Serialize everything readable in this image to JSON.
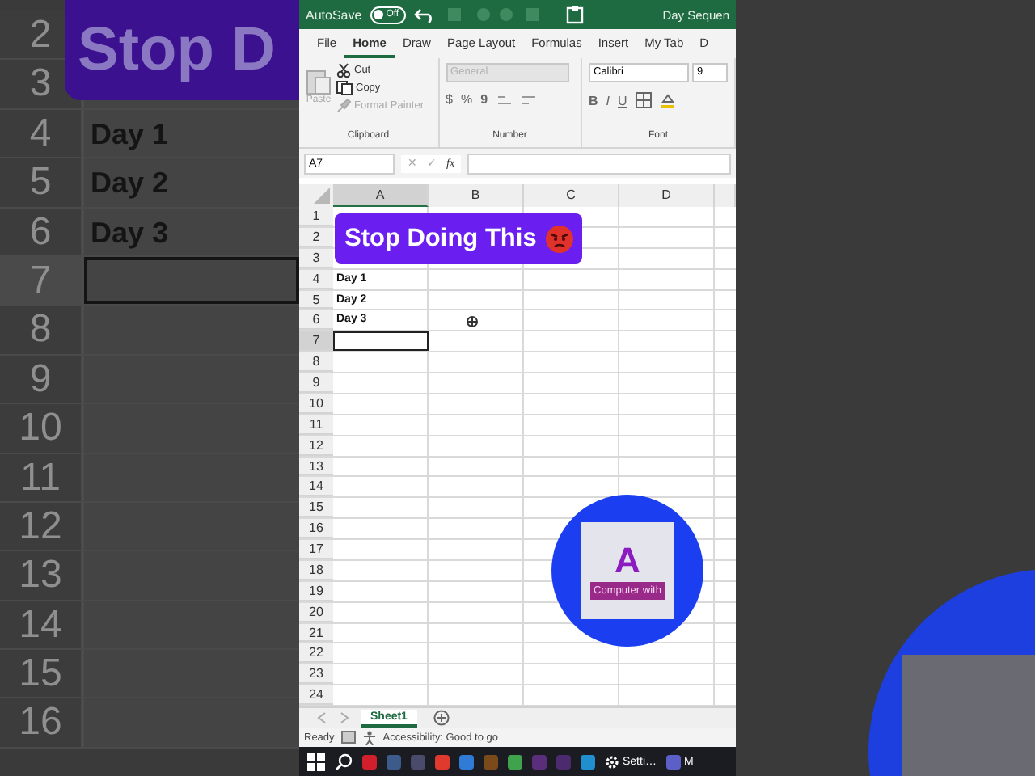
{
  "backdrop_left": {
    "banner_text": "Stop D",
    "rows": [
      {
        "number": "2",
        "selected": false,
        "cell": ""
      },
      {
        "number": "3",
        "selected": false,
        "cell": ""
      },
      {
        "number": "4",
        "selected": false,
        "cell": "Day 1"
      },
      {
        "number": "5",
        "selected": false,
        "cell": "Day 2"
      },
      {
        "number": "6",
        "selected": false,
        "cell": "Day 3"
      },
      {
        "number": "7",
        "selected": true,
        "cell": ""
      },
      {
        "number": "8",
        "selected": false,
        "cell": ""
      },
      {
        "number": "9",
        "selected": false,
        "cell": ""
      },
      {
        "number": "10",
        "selected": false,
        "cell": ""
      },
      {
        "number": "11",
        "selected": false,
        "cell": ""
      },
      {
        "number": "12",
        "selected": false,
        "cell": ""
      },
      {
        "number": "13",
        "selected": false,
        "cell": ""
      },
      {
        "number": "14",
        "selected": false,
        "cell": ""
      },
      {
        "number": "15",
        "selected": false,
        "cell": ""
      },
      {
        "number": "16",
        "selected": false,
        "cell": ""
      }
    ]
  },
  "title_bar": {
    "autosave_label": "AutoSave",
    "autosave_state": "Off",
    "autosave_on": false,
    "title": "Day Sequen"
  },
  "tabs": [
    {
      "label": "File",
      "selected": false
    },
    {
      "label": "Home",
      "selected": true
    },
    {
      "label": "Draw",
      "selected": false
    },
    {
      "label": "Page Layout",
      "selected": false
    },
    {
      "label": "Formulas",
      "selected": false
    },
    {
      "label": "Insert",
      "selected": false
    },
    {
      "label": "My Tab",
      "selected": false
    },
    {
      "label": "D",
      "selected": false
    }
  ],
  "ribbon": {
    "clipboard": {
      "paste": "Paste",
      "cut": "Cut",
      "copy": "Copy",
      "format_painter": "Format Painter",
      "label": "Clipboard"
    },
    "number": {
      "format": "General",
      "currency": "$",
      "percent": "%",
      "comma": "9",
      "label": "Number"
    },
    "font": {
      "name": "Calibri",
      "size": "9",
      "bold": "B",
      "italic": "I",
      "underline": "U",
      "label": "Font"
    }
  },
  "formula_bar": {
    "name_box": "A7",
    "cancel": "✕",
    "enter": "✓",
    "fx": "fx"
  },
  "sheet": {
    "columns": [
      {
        "label": "A",
        "selected": true
      },
      {
        "label": "B",
        "selected": false
      },
      {
        "label": "C",
        "selected": false
      },
      {
        "label": "D",
        "selected": false
      }
    ],
    "rows": [
      {
        "number": "1",
        "selected": false,
        "cell": ""
      },
      {
        "number": "2",
        "selected": false,
        "cell": ""
      },
      {
        "number": "3",
        "selected": false,
        "cell": ""
      },
      {
        "number": "4",
        "selected": false,
        "cell": "Day 1"
      },
      {
        "number": "5",
        "selected": false,
        "cell": "Day 2"
      },
      {
        "number": "6",
        "selected": false,
        "cell": "Day 3"
      },
      {
        "number": "7",
        "selected": true,
        "cell": ""
      },
      {
        "number": "8",
        "selected": false,
        "cell": ""
      },
      {
        "number": "9",
        "selected": false,
        "cell": ""
      },
      {
        "number": "10",
        "selected": false,
        "cell": ""
      },
      {
        "number": "11",
        "selected": false,
        "cell": ""
      },
      {
        "number": "12",
        "selected": false,
        "cell": ""
      },
      {
        "number": "13",
        "selected": false,
        "cell": ""
      },
      {
        "number": "14",
        "selected": false,
        "cell": ""
      },
      {
        "number": "15",
        "selected": false,
        "cell": ""
      },
      {
        "number": "16",
        "selected": false,
        "cell": ""
      },
      {
        "number": "17",
        "selected": false,
        "cell": ""
      },
      {
        "number": "18",
        "selected": false,
        "cell": ""
      },
      {
        "number": "19",
        "selected": false,
        "cell": ""
      },
      {
        "number": "20",
        "selected": false,
        "cell": ""
      },
      {
        "number": "21",
        "selected": false,
        "cell": ""
      },
      {
        "number": "22",
        "selected": false,
        "cell": ""
      },
      {
        "number": "23",
        "selected": false,
        "cell": ""
      },
      {
        "number": "24",
        "selected": false,
        "cell": ""
      }
    ]
  },
  "overlay_banner": {
    "text": "Stop Doing This"
  },
  "logo": {
    "letter": "A",
    "caption": "Computer with"
  },
  "sheet_tabs": [
    {
      "label": "Sheet1",
      "selected": true
    }
  ],
  "status_bar": {
    "mode": "Ready",
    "accessibility": "Accessibility: Good to go"
  },
  "taskbar": [
    {
      "kind": "start"
    },
    {
      "kind": "search"
    },
    {
      "kind": "app",
      "color": "#d21f2b"
    },
    {
      "kind": "app",
      "color": "#3c5a8a"
    },
    {
      "kind": "app",
      "color": "#4a4a6a"
    },
    {
      "kind": "app",
      "color": "#e03a2f"
    },
    {
      "kind": "app",
      "color": "#2f7bd6"
    },
    {
      "kind": "app",
      "color": "#7a4a1a"
    },
    {
      "kind": "app",
      "color": "#3fa34d"
    },
    {
      "kind": "app",
      "color": "#5a2e7a"
    },
    {
      "kind": "app",
      "color": "#4b2a6e"
    },
    {
      "kind": "app",
      "color": "#1f8fd0"
    },
    {
      "kind": "settings",
      "label": "Setti…"
    },
    {
      "kind": "app",
      "color": "#5b5fc7",
      "label": "M"
    }
  ]
}
